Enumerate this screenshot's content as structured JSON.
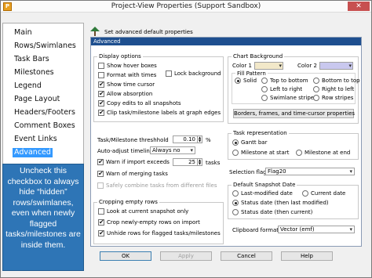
{
  "window": {
    "title": "Project-View Properties (Support Sandbox)",
    "close_label": "✕"
  },
  "nav": {
    "items": [
      "Main",
      "Rows/Swimlanes",
      "Task Bars",
      "Milestones",
      "Legend",
      "Page Layout",
      "Headers/Footers",
      "Comment Boxes",
      "Event Links",
      "Advanced"
    ],
    "selected": "Advanced"
  },
  "banner": {
    "text": "Set advanced default properties"
  },
  "panel": {
    "header": "Advanced"
  },
  "display_options": {
    "title": "Display options",
    "show_hover_boxes": "Show hover boxes",
    "format_with_times": "Format with times",
    "lock_background": "Lock background",
    "show_time_cursor": "Show time cursor",
    "allow_absorption": "Allow absorption",
    "copy_edits": "Copy edits to all snapshots",
    "clip_labels": "Clip task/milestone labels at graph edges"
  },
  "chart_background": {
    "title": "Chart Background",
    "color1_label": "Color 1",
    "color2_label": "Color 2",
    "color1": "#f2e8c9",
    "color2": "#c9c8ee",
    "fill_pattern_title": "Fill Pattern",
    "patterns": [
      "Solid",
      "Top to bottom",
      "Bottom to top",
      "Left to right",
      "Right to left",
      "Swimlane stripes",
      "Row stripes"
    ],
    "selected_pattern": "Solid",
    "borders_button": "Borders, frames, and time-cursor properties"
  },
  "task_milestone": {
    "threshold_label": "Task/Milestone threshhold",
    "threshold_value": "0.10",
    "threshold_unit": "%",
    "auto_adjust_label": "Auto-adjust timeline",
    "auto_adjust_value": "Always no",
    "warn_import_label": "Warn if import exceeds",
    "warn_import_value": "25",
    "warn_import_unit": "tasks",
    "warn_merging_label": "Warn of merging tasks",
    "safely_combine_label": "Safely combine tasks from different files"
  },
  "cropping": {
    "title": "Cropping empty rows",
    "look_current": "Look at current snapshot only",
    "crop_newly": "Crop newly-empty rows on import",
    "unhide_rows": "Unhide rows for flagged tasks/milestones"
  },
  "task_representation": {
    "title": "Task representation",
    "options": [
      "Gantt bar",
      "Milestone at start",
      "Milestone at end"
    ],
    "selected": "Gantt bar"
  },
  "selection_flag": {
    "label": "Selection flag",
    "value": "Flag20"
  },
  "default_snapshot_date": {
    "title": "Default Snapshot Date",
    "options": [
      "Last-modified date",
      "Current date",
      "Status date (then last modified)",
      "Status date (then current)"
    ],
    "selected": "Status date (then last modified)"
  },
  "clipboard": {
    "label": "Clipboard format",
    "value": "Vector (emf)"
  },
  "buttons": {
    "ok": "OK",
    "apply": "Apply",
    "cancel": "Cancel",
    "help": "Help"
  },
  "callout": {
    "text": "Uncheck this checkbox to always hide “hidden” rows/swimlanes, even when newly flagged tasks/milestones are inside them."
  }
}
